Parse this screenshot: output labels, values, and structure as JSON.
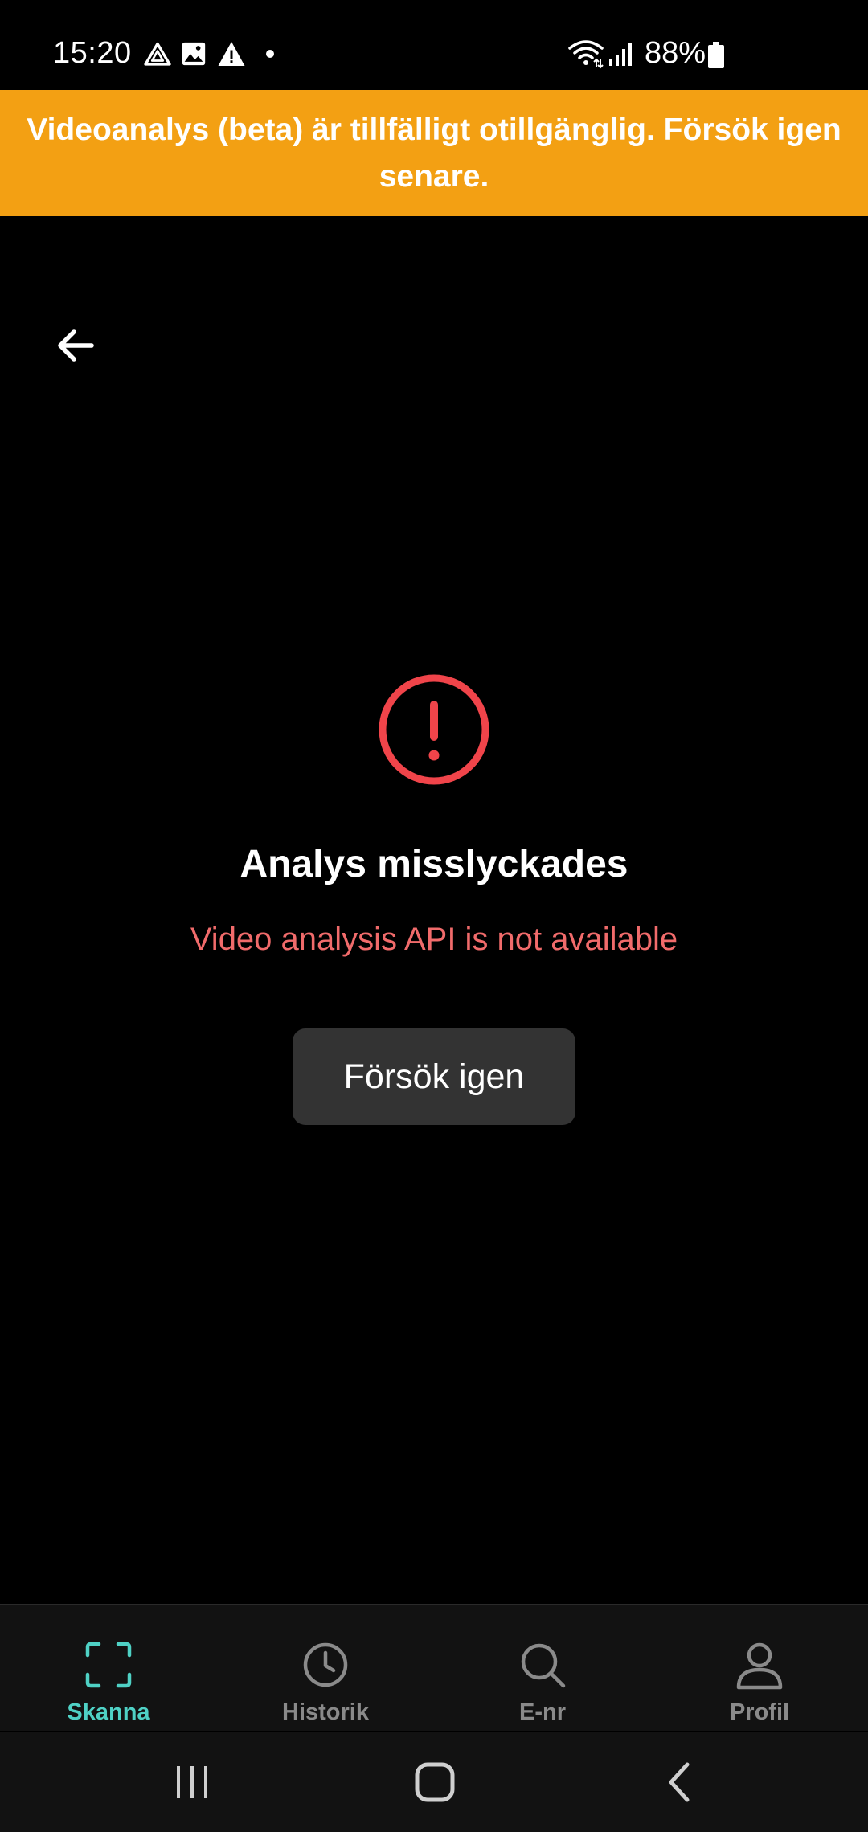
{
  "status_bar": {
    "time": "15:20",
    "battery_text": "88%",
    "icons": [
      "drive-icon",
      "image-icon",
      "warning-icon",
      "dot-icon",
      "wifi-icon",
      "signal-icon",
      "battery-icon"
    ]
  },
  "banner": {
    "text": "Videoanalys (beta) är tillfälligt otillgänglig. Försök igen senare.",
    "color": "#F3A013"
  },
  "header": {
    "back_icon": "arrow-left-icon"
  },
  "error": {
    "icon": "exclamation-circle-icon",
    "title": "Analys misslyckades",
    "message": "Video analysis API is not available",
    "retry_label": "Försök igen",
    "accent_color": "#F0444A",
    "message_color": "#F16B6B"
  },
  "bottom_nav": {
    "items": [
      {
        "label": "Skanna",
        "icon": "scan-icon",
        "active": true
      },
      {
        "label": "Historik",
        "icon": "clock-icon",
        "active": false
      },
      {
        "label": "E-nr",
        "icon": "search-icon",
        "active": false
      },
      {
        "label": "Profil",
        "icon": "user-icon",
        "active": false
      }
    ],
    "active_color": "#4FD1C5"
  },
  "system_nav": {
    "buttons": [
      "recent-apps-icon",
      "home-icon",
      "back-icon"
    ]
  }
}
